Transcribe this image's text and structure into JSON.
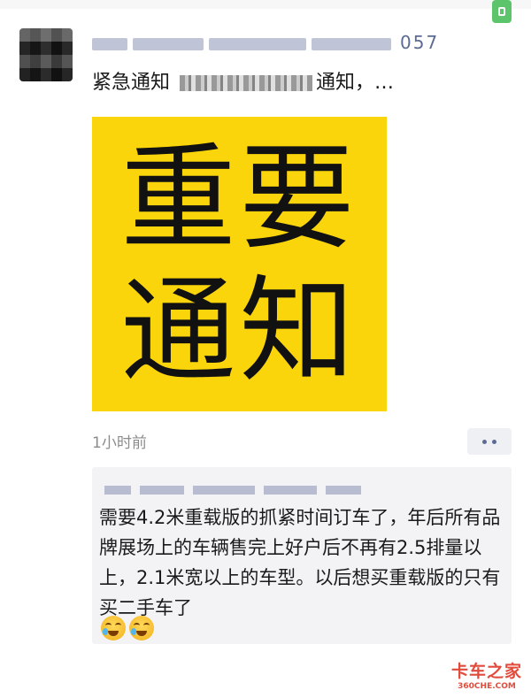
{
  "post": {
    "author_suffix": "057",
    "text_prefix": "紧急通知",
    "text_suffix": "通知，…",
    "image_lines": [
      "重要",
      "通知"
    ],
    "time": "1小时前"
  },
  "comment": {
    "text": "需要4.2米重载版的抓紧时间订车了，年后所有品牌展场上的车辆售完上好户后不再有2.5排量以上，2.1米宽以上的车型。以后想买重载版的只有买二手车了",
    "emoji": [
      "crying-laughing-emoji",
      "crying-laughing-emoji"
    ]
  },
  "watermark": {
    "main": "卡车之家",
    "sub": "360CHE.COM"
  },
  "colors": {
    "card_yellow": "#fbd50b",
    "link_blue": "#5b6b93",
    "watermark_red": "#e24b3b"
  },
  "icons": {
    "more": "more-dots-icon",
    "top_right": "phone-icon"
  }
}
